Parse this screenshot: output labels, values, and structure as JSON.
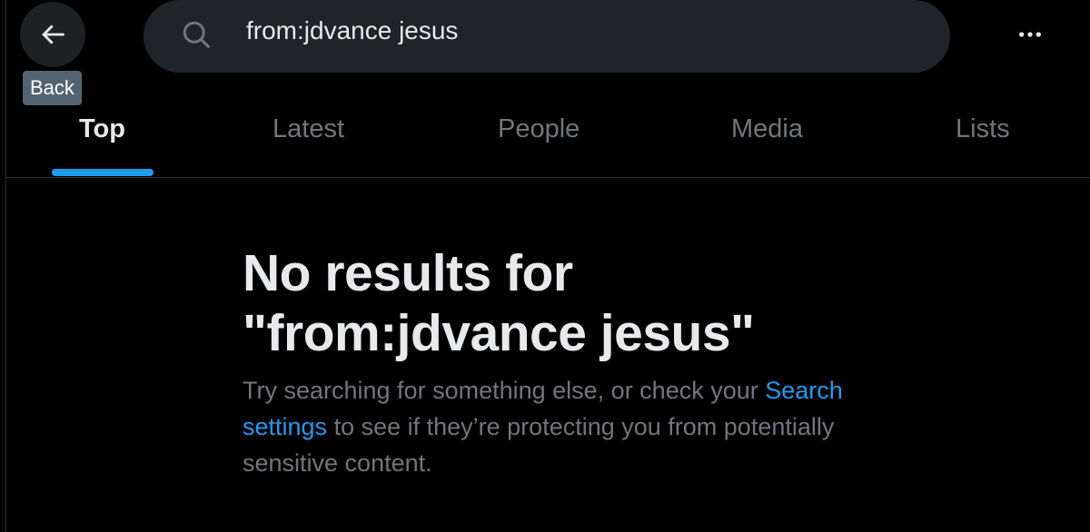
{
  "header": {
    "back_tooltip": "Back",
    "search": {
      "value": "from:jdvance jesus",
      "icon": "search-icon"
    }
  },
  "tabs": [
    {
      "label": "Top",
      "active": true
    },
    {
      "label": "Latest",
      "active": false
    },
    {
      "label": "People",
      "active": false
    },
    {
      "label": "Media",
      "active": false
    },
    {
      "label": "Lists",
      "active": false
    }
  ],
  "empty_state": {
    "title_line1": "No results for",
    "title_line2": "\"from:jdvance jesus\"",
    "desc_before": "Try searching for something else, or check your",
    "link_text": "Search settings",
    "desc_after": "to see if they’re protecting you from potentially sensitive content."
  },
  "colors": {
    "background": "#000000",
    "accent": "#1d9bf0",
    "muted_text": "#71767b",
    "primary_text": "#e7e9ea"
  }
}
